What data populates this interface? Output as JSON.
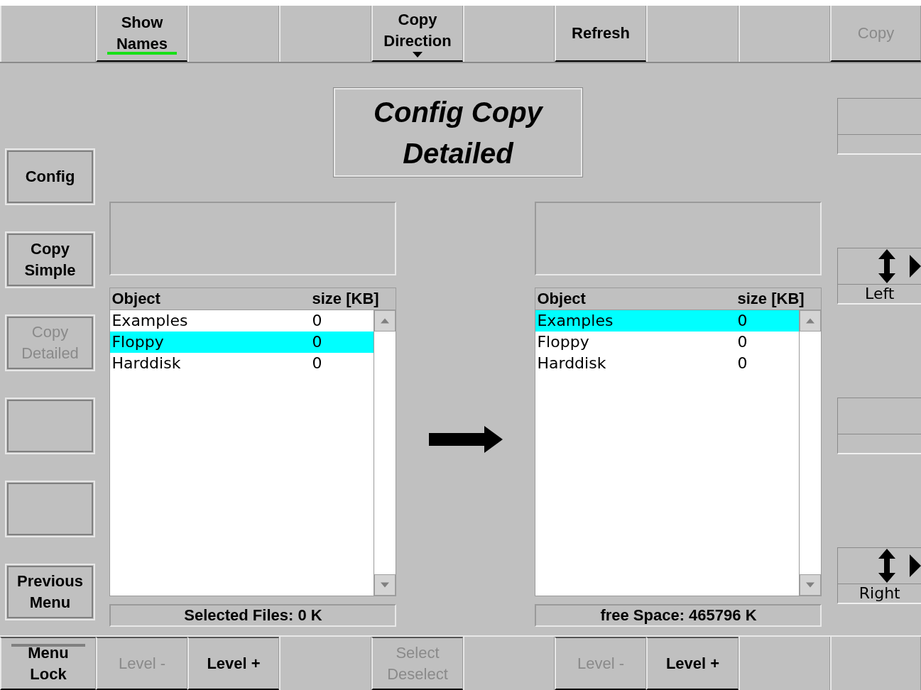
{
  "top_bar": [
    {
      "kind": "blank"
    },
    {
      "kind": "button",
      "label": "Show Names",
      "disabled": false,
      "lit": true
    },
    {
      "kind": "blank"
    },
    {
      "kind": "blank"
    },
    {
      "kind": "dropdown",
      "label": "Copy Direction",
      "disabled": false
    },
    {
      "kind": "blank"
    },
    {
      "kind": "button",
      "label": "Refresh",
      "disabled": false
    },
    {
      "kind": "blank"
    },
    {
      "kind": "blank"
    },
    {
      "kind": "button",
      "label": "Copy",
      "disabled": true
    }
  ],
  "title": "Config Copy Detailed",
  "side_menu": [
    {
      "kind": "button",
      "label": "Config",
      "disabled": false
    },
    {
      "kind": "button",
      "label": "Copy Simple",
      "disabled": false
    },
    {
      "kind": "button",
      "label": "Copy Detailed",
      "disabled": true
    },
    {
      "kind": "blank"
    },
    {
      "kind": "blank"
    },
    {
      "kind": "button",
      "label": "Previous Menu",
      "disabled": false
    }
  ],
  "panels": [
    {
      "columns": [
        "Object",
        "size [KB]"
      ],
      "rows": [
        {
          "name": "Examples",
          "size": "0",
          "selected": false
        },
        {
          "name": "Floppy",
          "size": "0",
          "selected": true
        },
        {
          "name": "Harddisk",
          "size": "0",
          "selected": false
        }
      ],
      "status": "Selected Files:  0 K"
    },
    {
      "columns": [
        "Object",
        "size [KB]"
      ],
      "rows": [
        {
          "name": "Examples",
          "size": "0",
          "selected": true
        },
        {
          "name": "Floppy",
          "size": "0",
          "selected": false
        },
        {
          "name": "Harddisk",
          "size": "0",
          "selected": false
        }
      ],
      "status": "free Space:  465796 K"
    }
  ],
  "right_controls": [
    {
      "kind": "blank"
    },
    {
      "kind": "scroll",
      "label": "Left"
    },
    {
      "kind": "blank"
    },
    {
      "kind": "scroll",
      "label": "Right"
    }
  ],
  "bottom_bar": [
    {
      "kind": "button",
      "label": "Menu Lock",
      "disabled": false,
      "lit": false
    },
    {
      "kind": "button",
      "label": "Level -",
      "disabled": true
    },
    {
      "kind": "button",
      "label": "Level +",
      "disabled": false
    },
    {
      "kind": "blank"
    },
    {
      "kind": "button",
      "label": "Select Deselect",
      "disabled": true
    },
    {
      "kind": "blank"
    },
    {
      "kind": "button",
      "label": "Level -",
      "disabled": true
    },
    {
      "kind": "button",
      "label": "Level +",
      "disabled": false
    },
    {
      "kind": "blank"
    },
    {
      "kind": "blank"
    }
  ]
}
